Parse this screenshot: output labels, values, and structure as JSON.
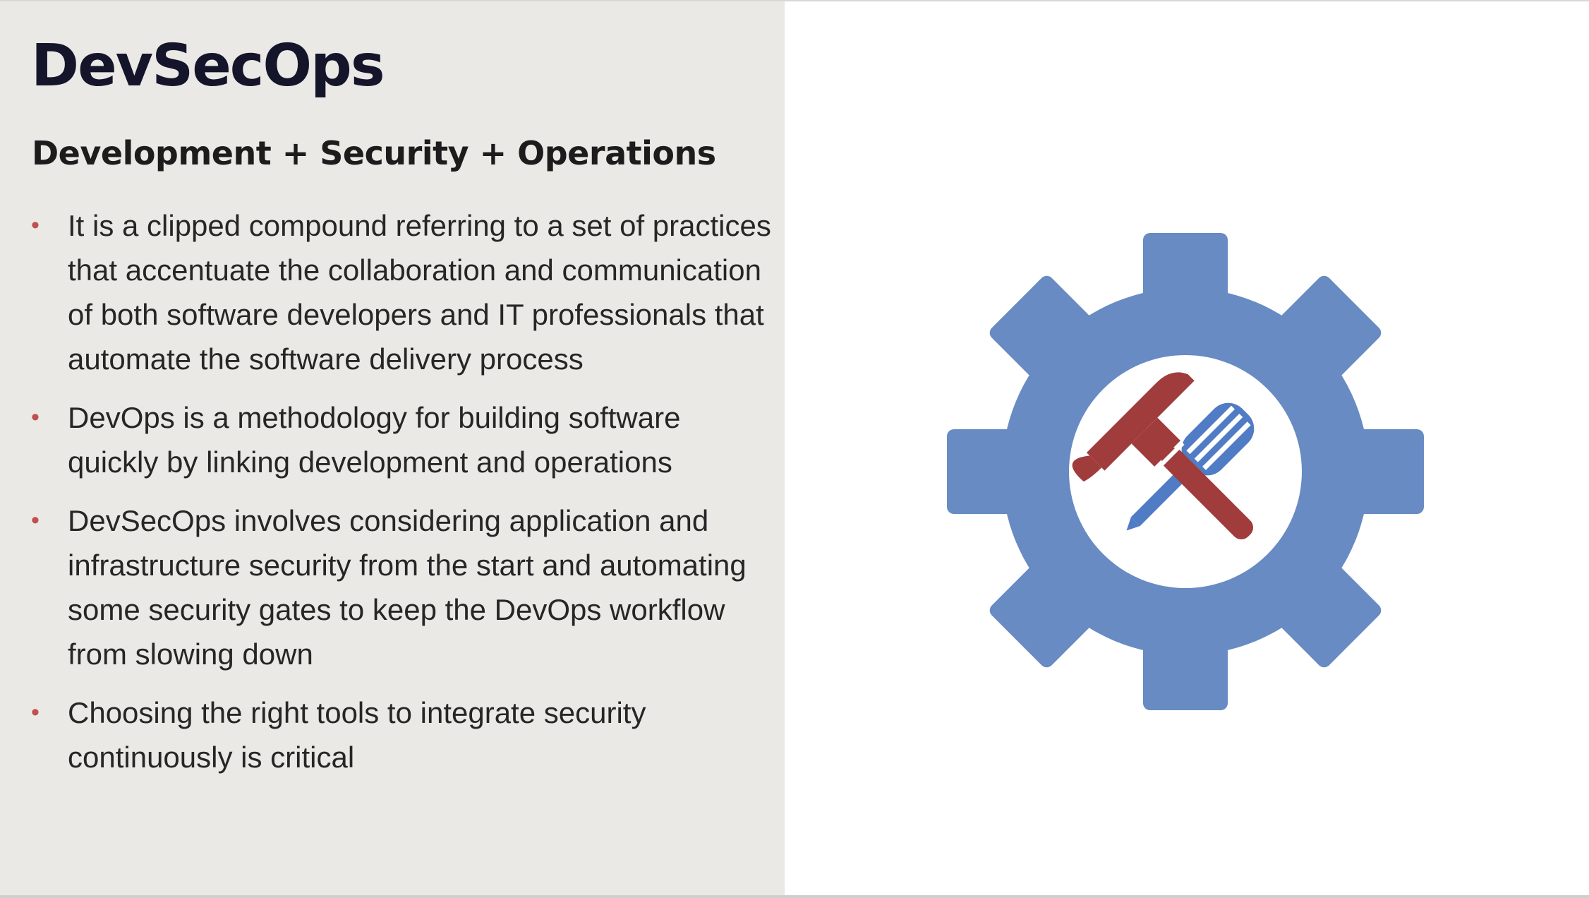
{
  "slide": {
    "title": "DevSecOps",
    "subtitle": "Development + Security + Operations",
    "bullets": [
      "It is a clipped compound referring to a set of practices that accentuate the collaboration and communication of both software developers and IT professionals that automate the software delivery process",
      "DevOps is a methodology for building software quickly by linking development and operations",
      "DevSecOps involves considering application and infrastructure security from the start and automating some security gates to keep the DevOps workflow from slowing down",
      "Choosing the right tools to integrate security continuously is critical"
    ],
    "bullet_marker": "•"
  },
  "illustration": {
    "icon": "gear-with-tools-icon",
    "gear_color": "#678bc2",
    "hammer_color": "#a03c3c",
    "screwdriver_color": "#4f7cc4"
  }
}
